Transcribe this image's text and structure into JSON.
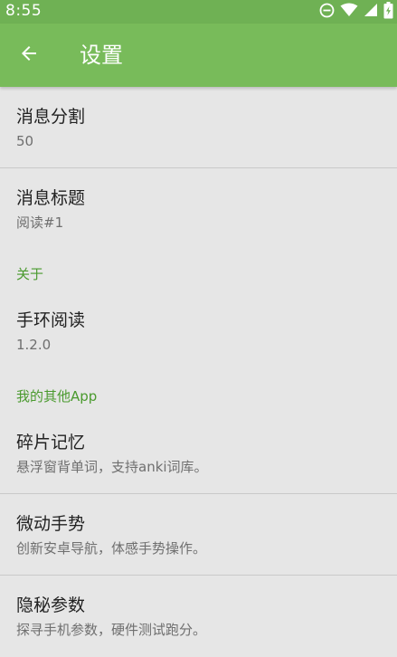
{
  "status_bar": {
    "time": "8:55",
    "icons": [
      "do-not-disturb-icon",
      "wifi-icon",
      "signal-icon",
      "battery-icon"
    ]
  },
  "app_bar": {
    "back_icon": "arrow-left-icon",
    "title": "设置"
  },
  "items": {
    "split": {
      "title": "消息分割",
      "value": "50"
    },
    "msg_title": {
      "title": "消息标题",
      "value": "阅读#1"
    }
  },
  "about": {
    "header": "关于",
    "app_name": "手环阅读",
    "version": "1.2.0"
  },
  "other_apps": {
    "header": "我的其他App",
    "apps": [
      {
        "title": "碎片记忆",
        "desc": "悬浮窗背单词，支持anki词库。"
      },
      {
        "title": "微动手势",
        "desc": "创新安卓导航，体感手势操作。"
      },
      {
        "title": "隐秘参数",
        "desc": "探寻手机参数，硬件测试跑分。"
      }
    ]
  },
  "colors": {
    "status_bar": "#6fb154",
    "app_bar": "#78bb5a",
    "accent": "#4a9a2e",
    "background": "#e6e6e6"
  }
}
